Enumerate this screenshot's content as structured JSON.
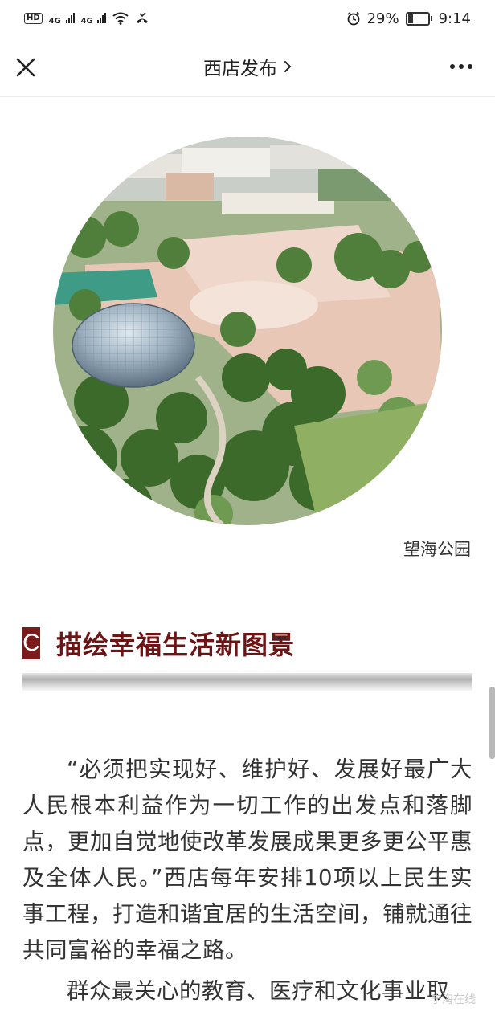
{
  "status_bar": {
    "left_icons": [
      "hd-icon",
      "4g-signal-icon",
      "4g-signal-icon",
      "wifi-icon",
      "missed-call-icon"
    ],
    "hd_label": "HD",
    "sim1_label": "4G",
    "sim2_label": "4G",
    "battery_percent": "29%",
    "battery_level": 0.29,
    "time": "9:14"
  },
  "nav": {
    "title": "西店发布",
    "title_chevron": "›",
    "close_icon": "close-icon",
    "more_icon": "more-dots-icon"
  },
  "photo": {
    "caption": "望海公园"
  },
  "section": {
    "letter": "C",
    "title": "描绘幸福生活新图景"
  },
  "article": {
    "paragraphs": [
      "“必须把实现好、维护好、发展好最广大人民根本利益作为一切工作的出发点和落脚点，更加自觉地使改革发展成果更多更公平惠及全体人民。”西店每年安排10项以上民生实事工程，打造和谐宜居的生活空间，铺就通往共同富裕的幸福之路。",
      "群众最关心的教育、医疗和文化事业取"
    ]
  },
  "watermark": "宁海在线"
}
